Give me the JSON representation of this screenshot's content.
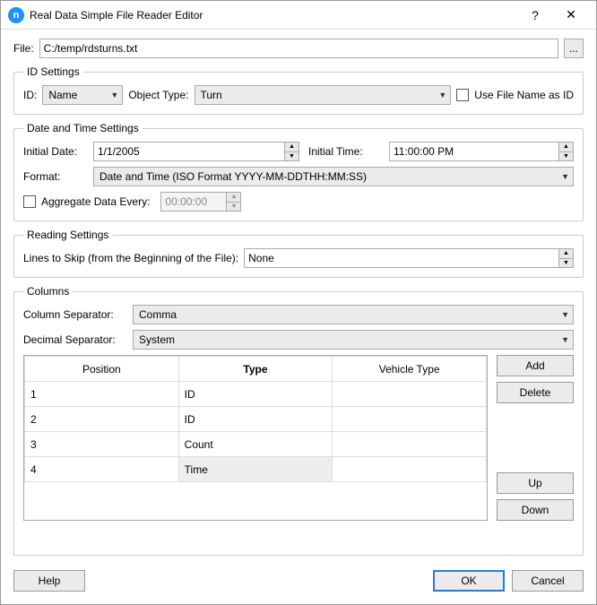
{
  "window": {
    "title": "Real Data Simple File Reader Editor",
    "icon_letter": "n",
    "help_glyph": "?",
    "close_glyph": "✕"
  },
  "file": {
    "label": "File:",
    "value": "C:/temp/rdsturns.txt",
    "browse_glyph": "..."
  },
  "id_settings": {
    "legend": "ID Settings",
    "id_label": "ID:",
    "id_value": "Name",
    "object_type_label": "Object Type:",
    "object_type_value": "Turn",
    "use_filename_label": "Use File Name as ID",
    "use_filename_checked": false
  },
  "datetime": {
    "legend": "Date and Time Settings",
    "initial_date_label": "Initial Date:",
    "initial_date_value": "1/1/2005",
    "initial_time_label": "Initial Time:",
    "initial_time_value": "11:00:00 PM",
    "format_label": "Format:",
    "format_value": "Date and Time (ISO Format YYYY-MM-DDTHH:MM:SS)",
    "aggregate_label": "Aggregate Data Every:",
    "aggregate_checked": false,
    "aggregate_value": "00:00:00"
  },
  "reading": {
    "legend": "Reading Settings",
    "lines_label": "Lines to Skip (from the Beginning of the File):",
    "lines_value": "None"
  },
  "columns": {
    "legend": "Columns",
    "column_sep_label": "Column Separator:",
    "column_sep_value": "Comma",
    "decimal_sep_label": "Decimal Separator:",
    "decimal_sep_value": "System",
    "headers": {
      "position": "Position",
      "type": "Type",
      "vehicle": "Vehicle Type"
    },
    "rows": [
      {
        "position": "1",
        "type": "ID",
        "vehicle": ""
      },
      {
        "position": "2",
        "type": "ID",
        "vehicle": ""
      },
      {
        "position": "3",
        "type": "Count",
        "vehicle": ""
      },
      {
        "position": "4",
        "type": "Time",
        "vehicle": ""
      }
    ],
    "selected_row": 3,
    "add_btn": "Add",
    "delete_btn": "Delete",
    "up_btn": "Up",
    "down_btn": "Down"
  },
  "footer": {
    "help": "Help",
    "ok": "OK",
    "cancel": "Cancel"
  }
}
